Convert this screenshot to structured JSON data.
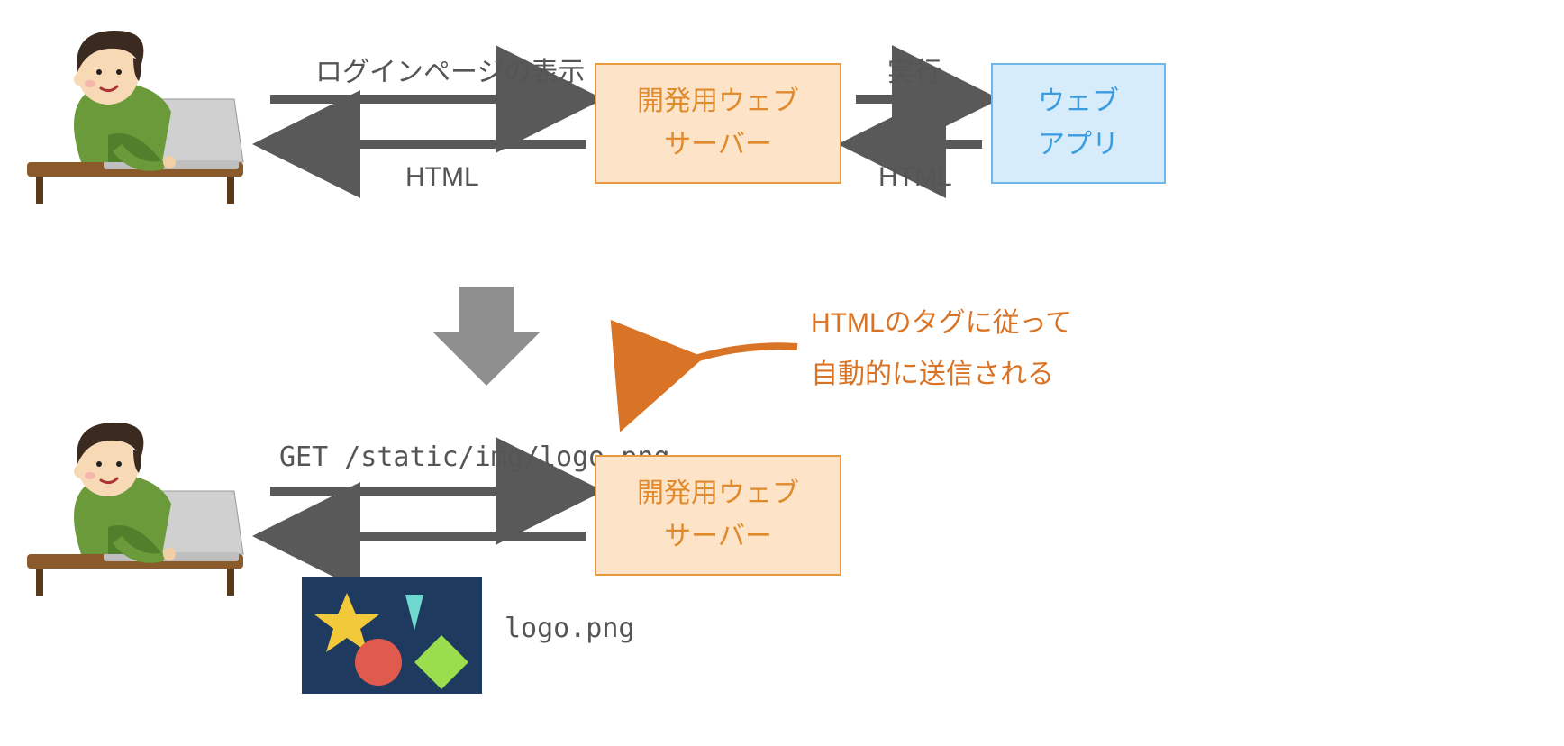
{
  "top": {
    "request_label": "ログインページの表示",
    "response_label": "HTML",
    "server_label": "開発用ウェブ\nサーバー",
    "app_label": "ウェブ\nアプリ",
    "exec_label": "実行",
    "exec_response_label": "HTML"
  },
  "bottom": {
    "request_label": "GET /static/img/logo.png",
    "server_label": "開発用ウェブ\nサーバー",
    "note_line1": "HTMLのタグに従って",
    "note_line2": "自動的に送信される",
    "file_label": "logo.png"
  },
  "colors": {
    "arrow": "#595959",
    "server_fill": "#fde4c8",
    "server_border": "#e99a3f",
    "server_text": "#e08a2c",
    "app_fill": "#d6ecfa",
    "app_border": "#6fb7e8",
    "app_text": "#3a9cdf",
    "note": "#d97326"
  }
}
